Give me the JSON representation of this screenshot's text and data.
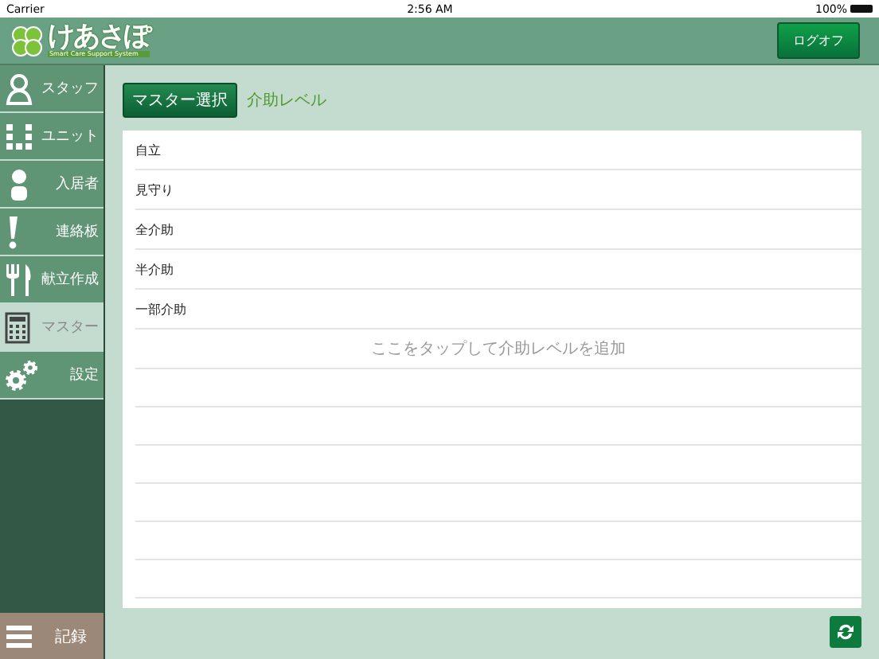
{
  "status_bar": {
    "carrier": "Carrier",
    "time": "2:56 AM",
    "battery": "100%"
  },
  "header": {
    "logo": "けあさぽ",
    "logo_subtitle": "Smart Care Support System",
    "logoff_button": "ログオフ"
  },
  "sidebar": {
    "items": [
      {
        "label": "スタッフ",
        "kind": "person",
        "selected": false
      },
      {
        "label": "ユニット",
        "kind": "unit",
        "selected": false
      },
      {
        "label": "入居者",
        "kind": "resident",
        "selected": false
      },
      {
        "label": "連絡板",
        "kind": "exclamation",
        "selected": false
      },
      {
        "label": "献立作成",
        "kind": "cutlery",
        "selected": false
      },
      {
        "label": "マスター",
        "kind": "calculator",
        "selected": true
      },
      {
        "label": "設定",
        "kind": "gears",
        "selected": false
      }
    ],
    "bottom_item": {
      "label": "記録"
    }
  },
  "toolbar": {
    "master_select_button": "マスター選択",
    "current_master": "介助レベル"
  },
  "list": {
    "rows": [
      "自立",
      "見守り",
      "全介助",
      "半介助",
      "一部介助"
    ],
    "add_hint": "ここをタップして介助レベルを追加"
  }
}
